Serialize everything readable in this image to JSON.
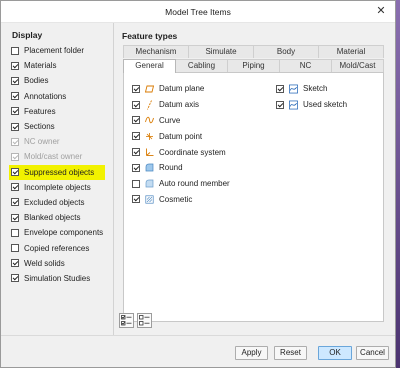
{
  "window": {
    "title": "Model Tree Items",
    "close_glyph": "✕"
  },
  "display": {
    "title": "Display",
    "items": [
      {
        "label": "Placement folder",
        "checked": false,
        "disabled": false,
        "highlighted": false
      },
      {
        "label": "Materials",
        "checked": true,
        "disabled": false,
        "highlighted": false
      },
      {
        "label": "Bodies",
        "checked": true,
        "disabled": false,
        "highlighted": false
      },
      {
        "label": "Annotations",
        "checked": true,
        "disabled": false,
        "highlighted": false
      },
      {
        "label": "Features",
        "checked": true,
        "disabled": false,
        "highlighted": false
      },
      {
        "label": "Sections",
        "checked": true,
        "disabled": false,
        "highlighted": false
      },
      {
        "label": "NC owner",
        "checked": true,
        "disabled": true,
        "highlighted": false
      },
      {
        "label": "Mold/cast owner",
        "checked": true,
        "disabled": true,
        "highlighted": false
      },
      {
        "label": "Suppressed objects",
        "checked": true,
        "disabled": false,
        "highlighted": true
      },
      {
        "label": "Incomplete objects",
        "checked": true,
        "disabled": false,
        "highlighted": false
      },
      {
        "label": "Excluded objects",
        "checked": true,
        "disabled": false,
        "highlighted": false
      },
      {
        "label": "Blanked objects",
        "checked": true,
        "disabled": false,
        "highlighted": false
      },
      {
        "label": "Envelope components",
        "checked": false,
        "disabled": false,
        "highlighted": false
      },
      {
        "label": "Copied references",
        "checked": false,
        "disabled": false,
        "highlighted": false
      },
      {
        "label": "Weld solids",
        "checked": true,
        "disabled": false,
        "highlighted": false
      },
      {
        "label": "Simulation Studies",
        "checked": true,
        "disabled": false,
        "highlighted": false
      }
    ]
  },
  "feature_types": {
    "title": "Feature types",
    "tabs_row1": [
      "Mechanism",
      "Simulate",
      "Body",
      "Material"
    ],
    "tabs_row2": [
      "General",
      "Cabling",
      "Piping",
      "NC",
      "Mold/Cast"
    ],
    "active_tab": "General",
    "col1": [
      {
        "label": "Datum plane",
        "checked": true,
        "icon": "datum-plane-icon"
      },
      {
        "label": "Datum axis",
        "checked": true,
        "icon": "datum-axis-icon"
      },
      {
        "label": "Curve",
        "checked": true,
        "icon": "curve-icon"
      },
      {
        "label": "Datum point",
        "checked": true,
        "icon": "datum-point-icon"
      },
      {
        "label": "Coordinate system",
        "checked": true,
        "icon": "coordinate-system-icon"
      },
      {
        "label": "Round",
        "checked": true,
        "icon": "round-icon"
      },
      {
        "label": "Auto round member",
        "checked": false,
        "icon": "auto-round-icon"
      },
      {
        "label": "Cosmetic",
        "checked": true,
        "icon": "cosmetic-icon"
      }
    ],
    "col2": [
      {
        "label": "Sketch",
        "checked": true,
        "icon": "sketch-icon"
      },
      {
        "label": "Used sketch",
        "checked": true,
        "icon": "used-sketch-icon"
      }
    ]
  },
  "buttons": {
    "apply": "Apply",
    "reset": "Reset",
    "ok": "OK",
    "cancel": "Cancel"
  },
  "colors": {
    "highlight": "#f2f200",
    "accent": "#cde8ff",
    "icon_blue": "#1a5fb4",
    "icon_orange": "#d97a00"
  }
}
